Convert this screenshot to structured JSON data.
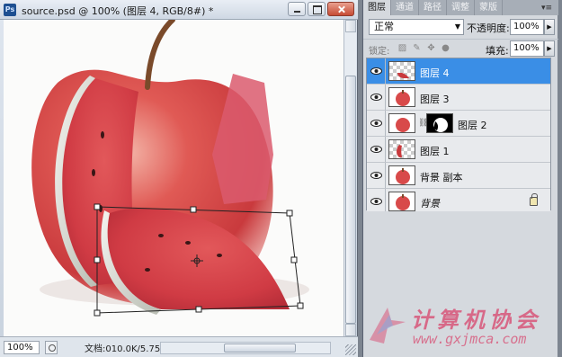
{
  "document": {
    "title": "source.psd @ 100% (图层 4, RGB/8#) *",
    "app_icon": "Ps",
    "zoom": "100%",
    "info": "文档:010.0K/5.75M",
    "window_buttons": [
      "minimize-icon",
      "maximize-icon",
      "close-icon"
    ]
  },
  "panel": {
    "tabs": [
      "图层",
      "通道",
      "路径",
      "调整",
      "蒙版"
    ],
    "active_tab": 0,
    "menu_glyph": "▾≡",
    "blend_mode": "正常",
    "opacity_label": "不透明度:",
    "opacity": "100%",
    "lock_label": "锁定:",
    "fill_label": "填充:",
    "fill": "100%"
  },
  "layers": [
    {
      "name": "图层 4",
      "selected": true,
      "italic": false,
      "mask": false,
      "locked": false
    },
    {
      "name": "图层 3",
      "selected": false,
      "italic": false,
      "mask": false,
      "locked": false
    },
    {
      "name": "图层 2",
      "selected": false,
      "italic": false,
      "mask": true,
      "locked": false
    },
    {
      "name": "图层 1",
      "selected": false,
      "italic": false,
      "mask": false,
      "locked": false
    },
    {
      "name": "背景 副本",
      "selected": false,
      "italic": false,
      "mask": false,
      "locked": false
    },
    {
      "name": "背景",
      "selected": false,
      "italic": true,
      "mask": false,
      "locked": true
    }
  ],
  "watermark": {
    "text": "计算机协会",
    "url": "www.gxjmca.com"
  },
  "colors": {
    "selection": "#3a8ee6",
    "apple_red": "#d84a4a",
    "watermark": "#d8567a"
  }
}
